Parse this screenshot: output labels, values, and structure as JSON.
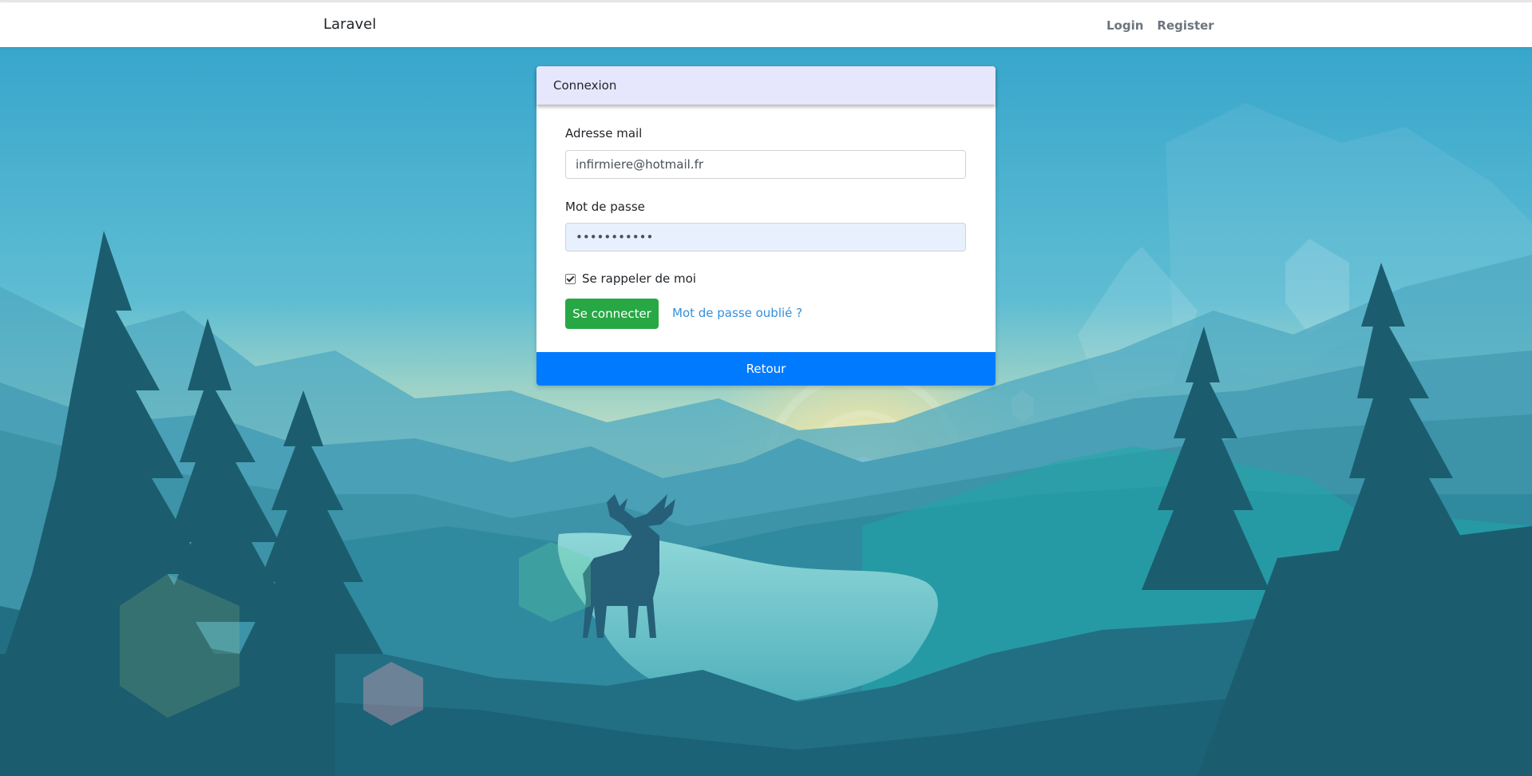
{
  "navbar": {
    "brand": "Laravel",
    "links": [
      "Login",
      "Register"
    ]
  },
  "login_card": {
    "title": "Connexion",
    "email_label": "Adresse mail",
    "email_value": "infirmiere@hotmail.fr",
    "password_label": "Mot de passe",
    "password_value": "•••••••••••",
    "remember_label": "Se rappeler de moi",
    "remember_checked": true,
    "submit_label": "Se connecter",
    "forgot_label": "Mot de passe oublié ?",
    "back_label": "Retour"
  },
  "colors": {
    "header_bg": "#e6e6fd",
    "success": "#28a745",
    "primary": "#007bff",
    "link": "#3490dc",
    "autofill": "#e8f0fe"
  },
  "icons": {
    "background": "forest-lake-deer-illustration"
  }
}
